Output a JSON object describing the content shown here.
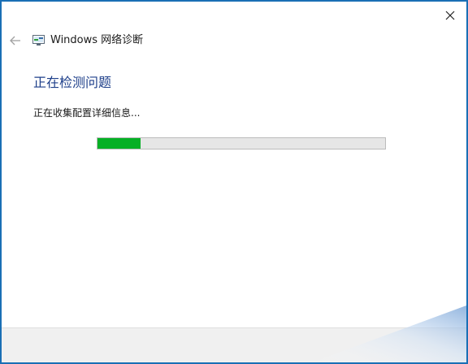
{
  "window": {
    "title": "Windows 网络诊断"
  },
  "main": {
    "heading": "正在检测问题",
    "status_text": "正在收集配置详细信息..."
  },
  "progress": {
    "fraction": 0.15
  },
  "icons": {
    "close": "close-icon",
    "back": "back-arrow-icon",
    "app": "network-diagnostics-icon"
  },
  "colors": {
    "heading": "#1e3f8a",
    "progress_fill": "#06b025",
    "window_border": "#1a6fb5"
  }
}
